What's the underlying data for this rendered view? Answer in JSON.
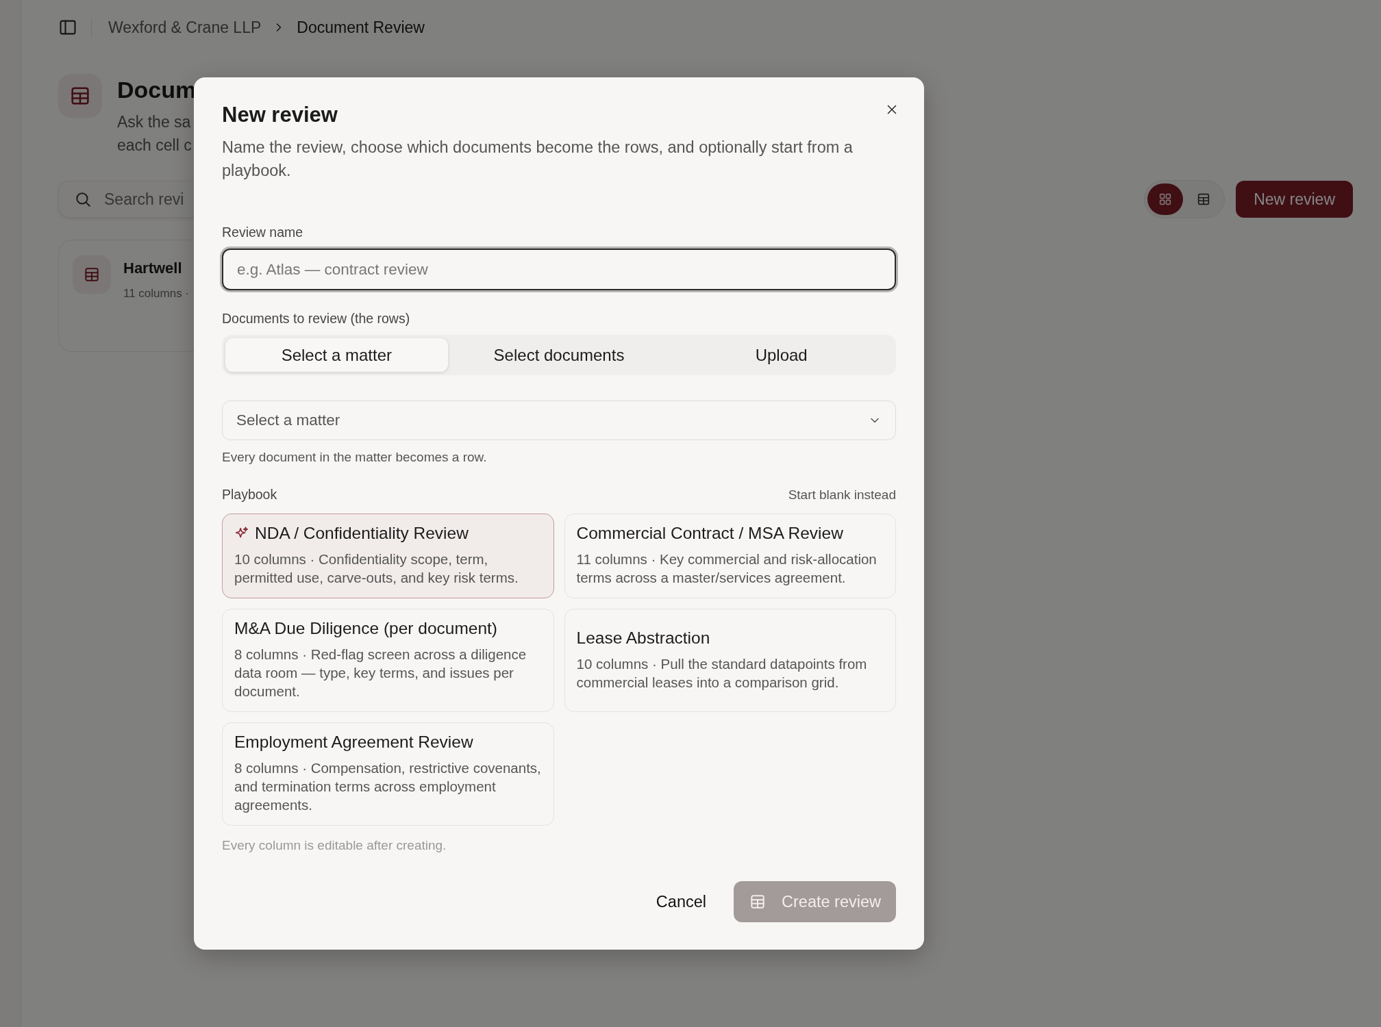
{
  "breadcrumb": [
    {
      "label": "Wexford & Crane LLP",
      "current": false
    },
    {
      "label": "Document Review",
      "current": true
    }
  ],
  "page": {
    "title": "Docum",
    "description_lines": [
      "Ask the sa",
      "each cell c"
    ]
  },
  "search": {
    "placeholder": "Search revi"
  },
  "view_toggle": [
    {
      "kind": "grid",
      "selected": true
    },
    {
      "kind": "table",
      "selected": false
    }
  ],
  "new_review_button": "New review",
  "reviews": [
    {
      "title": "Hartwell",
      "meta": "11 columns ·"
    }
  ],
  "dialog": {
    "title": "New review",
    "description": "Name the review, choose which documents become the rows, and optionally start from a playbook.",
    "review_name": {
      "label": "Review name",
      "placeholder": "e.g. Atlas — contract review"
    },
    "documents": {
      "label": "Documents to review (the rows)",
      "tabs": [
        {
          "label": "Select a matter",
          "selected": true
        },
        {
          "label": "Select documents",
          "selected": false
        },
        {
          "label": "Upload",
          "selected": false
        }
      ],
      "select": {
        "placeholder": "Select a matter"
      },
      "hint": "Every document in the matter becomes a row."
    },
    "playbook": {
      "label": "Playbook",
      "link": "Start blank instead",
      "items": [
        {
          "title": "NDA / Confidentiality Review",
          "description": "10 columns · Confidentiality scope, term, permitted use, carve-outs, and key risk terms.",
          "selected": true
        },
        {
          "title": "Commercial Contract / MSA Review",
          "description": "11 columns · Key commercial and risk-allocation terms across a master/services agreement.",
          "selected": false
        },
        {
          "title": "M&A Due Diligence (per document)",
          "description": "8 columns · Red-flag screen across a diligence data room — type, key terms, and issues per document.",
          "selected": false
        },
        {
          "title": "Lease Abstraction",
          "description": "10 columns · Pull the standard datapoints from commercial leases into a comparison grid.",
          "selected": false
        },
        {
          "title": "Employment Agreement Review",
          "description": "8 columns · Compensation, restrictive covenants, and termination terms across employment agreements.",
          "selected": false
        }
      ],
      "note": "Every column is editable after creating."
    },
    "buttons": [
      {
        "kind": "cancel",
        "label": "Cancel",
        "disabled": false
      },
      {
        "kind": "create",
        "label": "Create review",
        "disabled": true
      }
    ]
  }
}
